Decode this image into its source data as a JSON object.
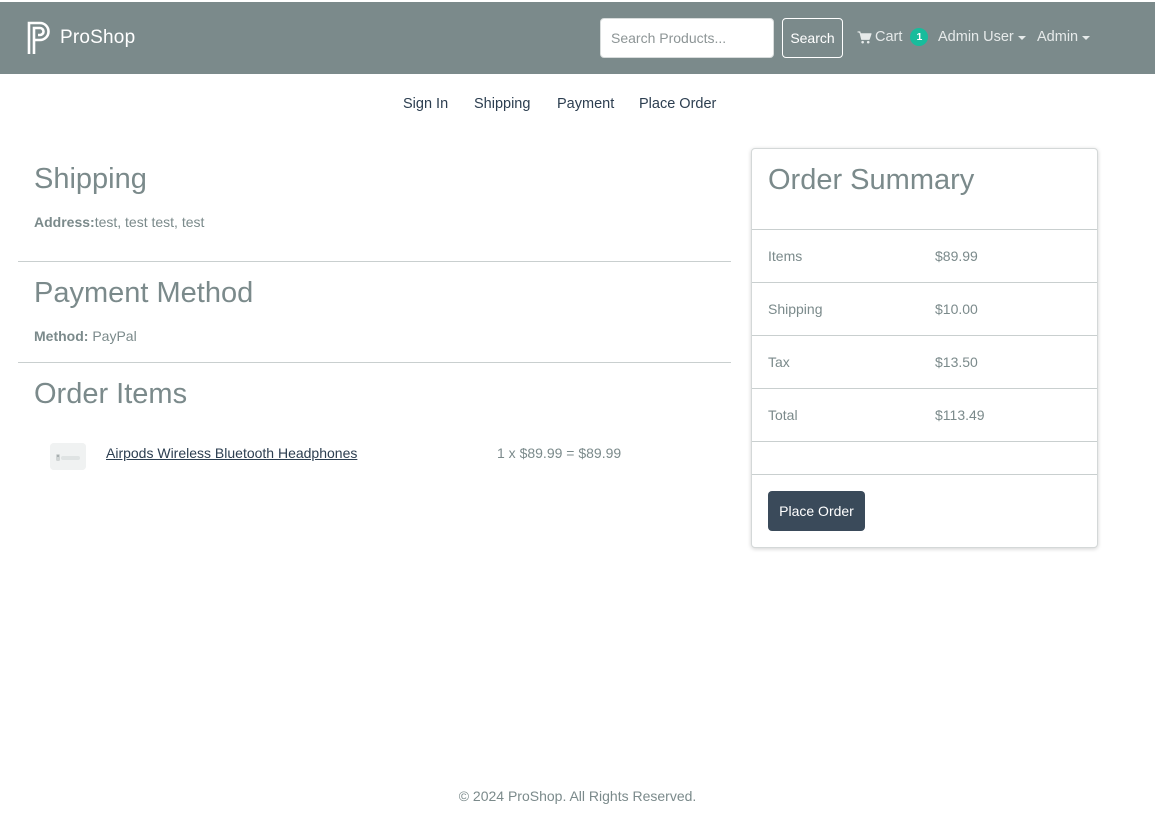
{
  "navbar": {
    "brand": "ProShop",
    "search_placeholder": "Search Products...",
    "search_button": "Search",
    "cart_label": "Cart",
    "cart_count": "1",
    "user_menu": "Admin User",
    "admin_menu": "Admin"
  },
  "steps": [
    "Sign In",
    "Shipping",
    "Payment",
    "Place Order"
  ],
  "shipping": {
    "title": "Shipping",
    "address_label": "Address:",
    "address_value": "test, test test, test"
  },
  "payment": {
    "title": "Payment Method",
    "method_label": "Method:",
    "method_value": "PayPal"
  },
  "order_items": {
    "title": "Order Items",
    "items": [
      {
        "name": "Airpods Wireless Bluetooth Headphones",
        "calc": "1 x $89.99 = $89.99"
      }
    ]
  },
  "summary": {
    "title": "Order Summary",
    "rows": [
      {
        "label": "Items",
        "value": "$89.99"
      },
      {
        "label": "Shipping",
        "value": "$10.00"
      },
      {
        "label": "Tax",
        "value": "$13.50"
      },
      {
        "label": "Total",
        "value": "$113.49"
      }
    ],
    "button": "Place Order"
  },
  "footer": "© 2024 ProShop. All Rights Reserved.",
  "colors": {
    "navbar": "#7b8a8b",
    "badge": "#18bc9c",
    "primary_button": "#3a4a5a",
    "text_dark": "#2c3e50"
  }
}
